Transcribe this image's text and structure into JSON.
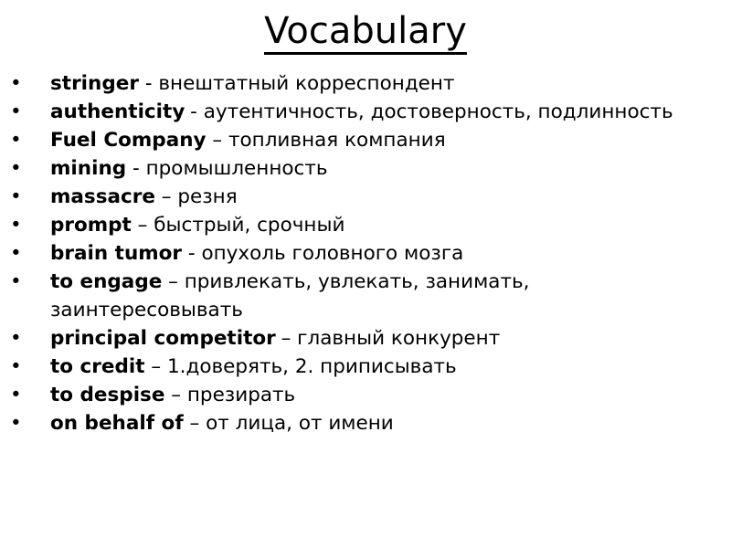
{
  "slide": {
    "title": "Vocabulary",
    "background_color": "#ffffff",
    "text_color": "#000000",
    "bullet_glyph": "•"
  },
  "vocabulary": [
    {
      "term": "stringer",
      "separator": " - ",
      "definition": "внештатный корреспондент",
      "tight": false
    },
    {
      "term": "authenticity",
      "separator": " -",
      "definition": " аутентичность, достоверность, подлинность",
      "tight": true
    },
    {
      "term": "Fuel Company",
      "separator": " – ",
      "definition": "топливная компания",
      "tight": false
    },
    {
      "term": "mining",
      "separator": " - ",
      "definition": "промышленность",
      "tight": false
    },
    {
      "term": "massacre",
      "separator": " – ",
      "definition": "резня",
      "tight": false
    },
    {
      "term": "prompt",
      "separator": " – ",
      "definition": "быстрый, срочный",
      "tight": false
    },
    {
      "term": "brain tumor",
      "separator": " - ",
      "definition": "опухоль головного мозга",
      "tight": false
    },
    {
      "term": "to engage",
      "separator": " – ",
      "definition": "привлекать, увлекать, занимать, заинтересовывать",
      "tight": false
    },
    {
      "term": "principal competitor",
      "separator": " – ",
      "definition": "главный конкурент",
      "tight": true
    },
    {
      "term": "to credit",
      "separator": " – ",
      "definition": "1.доверять, 2. приписывать",
      "tight": false
    },
    {
      "term": "to despise",
      "separator": " – ",
      "definition": "презирать",
      "tight": false
    },
    {
      "term": "on behalf of",
      "separator": " – ",
      "definition": "от лица, от имени",
      "tight": false
    }
  ]
}
